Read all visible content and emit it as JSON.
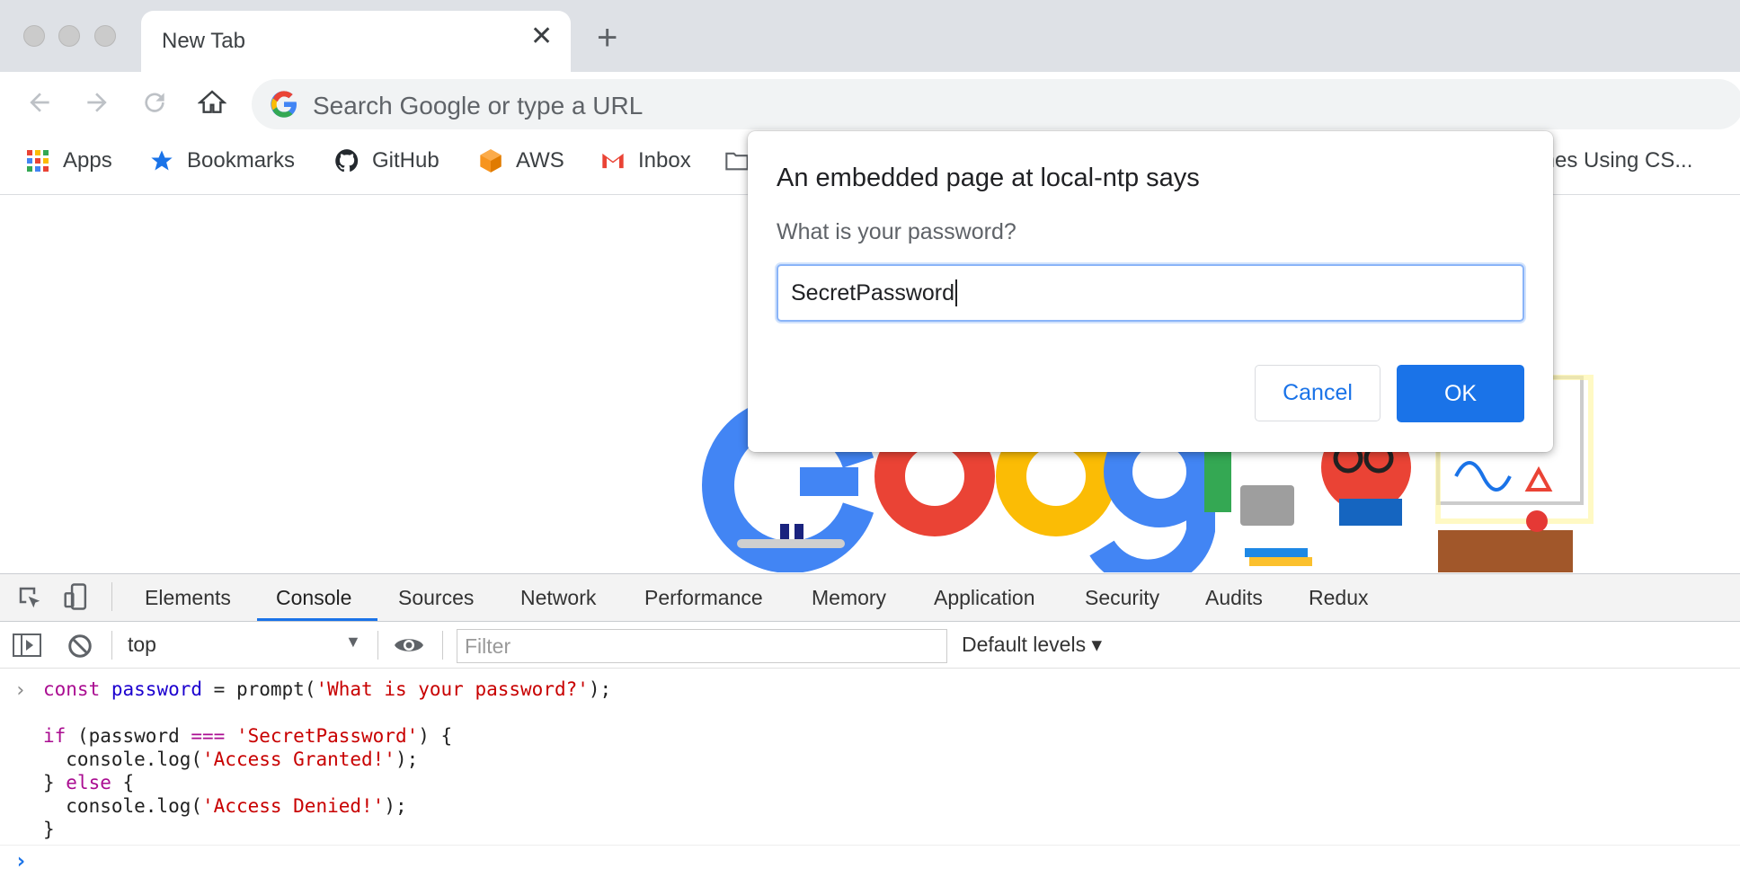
{
  "browser": {
    "tab": {
      "title": "New Tab",
      "close_icon": "close-icon"
    },
    "omnibox": {
      "placeholder": "Search Google or type a URL"
    },
    "bookmarks": [
      {
        "label": "Apps",
        "icon": "apps-grid-icon"
      },
      {
        "label": "Bookmarks",
        "icon": "star-icon"
      },
      {
        "label": "GitHub",
        "icon": "github-icon"
      },
      {
        "label": "AWS",
        "icon": "aws-cube-icon"
      },
      {
        "label": "Inbox",
        "icon": "gmail-icon"
      },
      {
        "label": "",
        "icon": "folder-icon"
      },
      {
        "label": "mes Using CS...",
        "icon": ""
      }
    ]
  },
  "dialog": {
    "title": "An embedded page at local-ntp says",
    "message": "What is your password?",
    "input_value": "SecretPassword",
    "cancel_label": "Cancel",
    "ok_label": "OK"
  },
  "devtools": {
    "tabs": [
      "Elements",
      "Console",
      "Sources",
      "Network",
      "Performance",
      "Memory",
      "Application",
      "Security",
      "Audits",
      "Redux"
    ],
    "active_tab": "Console",
    "context": "top",
    "filter_placeholder": "Filter",
    "levels": "Default levels ▾",
    "code": {
      "l1_kw": "const",
      "l1_var": "password",
      "l1_a": " = prompt(",
      "l1_str": "'What is your password?'",
      "l1_b": ");",
      "l2_kw": "if",
      "l2_a": " (password ",
      "l2_op": "===",
      "l2_sp": " ",
      "l2_str": "'SecretPassword'",
      "l2_b": ") {",
      "l3_a": "  console.log(",
      "l3_str": "'Access Granted!'",
      "l3_b": ");",
      "l4_a": "} ",
      "l4_kw": "else",
      "l4_b": " {",
      "l5_a": "  console.log(",
      "l5_str": "'Access Denied!'",
      "l5_b": ");",
      "l6": "}"
    }
  },
  "colors": {
    "accent": "#1a73e8",
    "code_keyword": "#aa0d91",
    "code_string": "#c80000",
    "code_variable": "#1c00cf"
  }
}
